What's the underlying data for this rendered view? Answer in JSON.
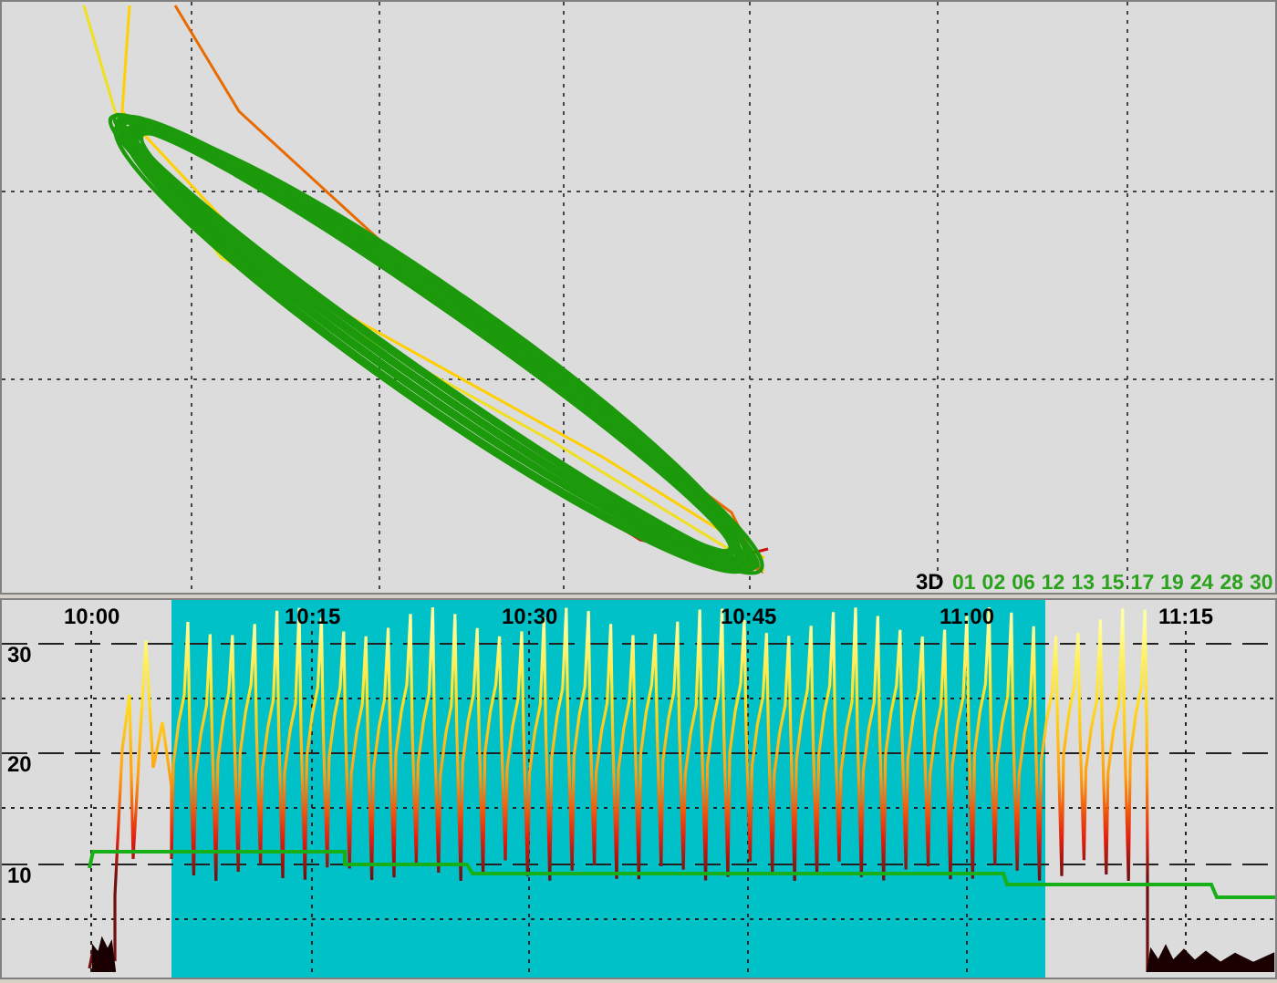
{
  "phase_plot": {
    "legend_label": "3D",
    "legend_items": [
      "01",
      "02",
      "06",
      "12",
      "13",
      "15",
      "17",
      "19",
      "24",
      "28",
      "30"
    ]
  },
  "time_plot": {
    "x_labels": [
      "10:00",
      "10:15",
      "10:30",
      "10:45",
      "11:00",
      "11:15"
    ],
    "y_labels": [
      "30",
      "20",
      "10"
    ]
  }
}
